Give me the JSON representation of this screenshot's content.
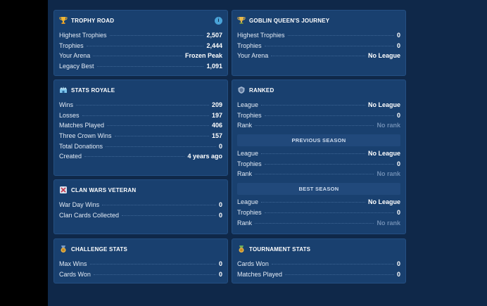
{
  "trophy_road": {
    "title": "TROPHY ROAD",
    "corner_badge": "i",
    "rows": [
      {
        "label": "Highest Trophies",
        "value": "2,507"
      },
      {
        "label": "Trophies",
        "value": "2,444"
      },
      {
        "label": "Your Arena",
        "value": "Frozen Peak"
      },
      {
        "label": "Legacy Best",
        "value": "1,091"
      }
    ]
  },
  "goblin": {
    "title": "GOBLIN QUEEN'S JOURNEY",
    "rows": [
      {
        "label": "Highest Trophies",
        "value": "0"
      },
      {
        "label": "Trophies",
        "value": "0"
      },
      {
        "label": "Your Arena",
        "value": "No League"
      }
    ]
  },
  "stats_royale": {
    "title": "STATS ROYALE",
    "rows": [
      {
        "label": "Wins",
        "value": "209"
      },
      {
        "label": "Losses",
        "value": "197"
      },
      {
        "label": "Matches Played",
        "value": "406"
      },
      {
        "label": "Three Crown Wins",
        "value": "157"
      },
      {
        "label": "Total Donations",
        "value": "0"
      },
      {
        "label": "Created",
        "value": "4 years ago"
      }
    ]
  },
  "ranked": {
    "title": "RANKED",
    "current": [
      {
        "label": "League",
        "value": "No League"
      },
      {
        "label": "Trophies",
        "value": "0"
      },
      {
        "label": "Rank",
        "value": "No rank"
      }
    ],
    "previous_title": "PREVIOUS SEASON",
    "previous": [
      {
        "label": "League",
        "value": "No League"
      },
      {
        "label": "Trophies",
        "value": "0"
      },
      {
        "label": "Rank",
        "value": "No rank"
      }
    ],
    "best_title": "BEST SEASON",
    "best": [
      {
        "label": "League",
        "value": "No League"
      },
      {
        "label": "Trophies",
        "value": "0"
      },
      {
        "label": "Rank",
        "value": "No rank"
      }
    ]
  },
  "clan_wars": {
    "title": "CLAN WARS VETERAN",
    "rows": [
      {
        "label": "War Day Wins",
        "value": "0"
      },
      {
        "label": "Clan Cards Collected",
        "value": "0"
      }
    ]
  },
  "challenge": {
    "title": "CHALLENGE STATS",
    "rows": [
      {
        "label": "Max Wins",
        "value": "0"
      },
      {
        "label": "Cards Won",
        "value": "0"
      }
    ]
  },
  "tournament": {
    "title": "TOURNAMENT STATS",
    "rows": [
      {
        "label": "Cards Won",
        "value": "0"
      },
      {
        "label": "Matches Played",
        "value": "0"
      }
    ]
  },
  "colors": {
    "background": "#0f2849",
    "card": "#19406f",
    "dim_value": "#6e8cb2",
    "trophy_gold": "#f2b632"
  },
  "icons": {
    "trophy_road": "trophy-icon",
    "goblin": "trophy-icon",
    "stats_royale": "crown-arena-icon",
    "ranked": "ranked-shield-icon",
    "clan_wars": "crossed-swords-icon",
    "challenge": "challenge-medal-icon",
    "tournament": "tournament-medal-icon"
  }
}
